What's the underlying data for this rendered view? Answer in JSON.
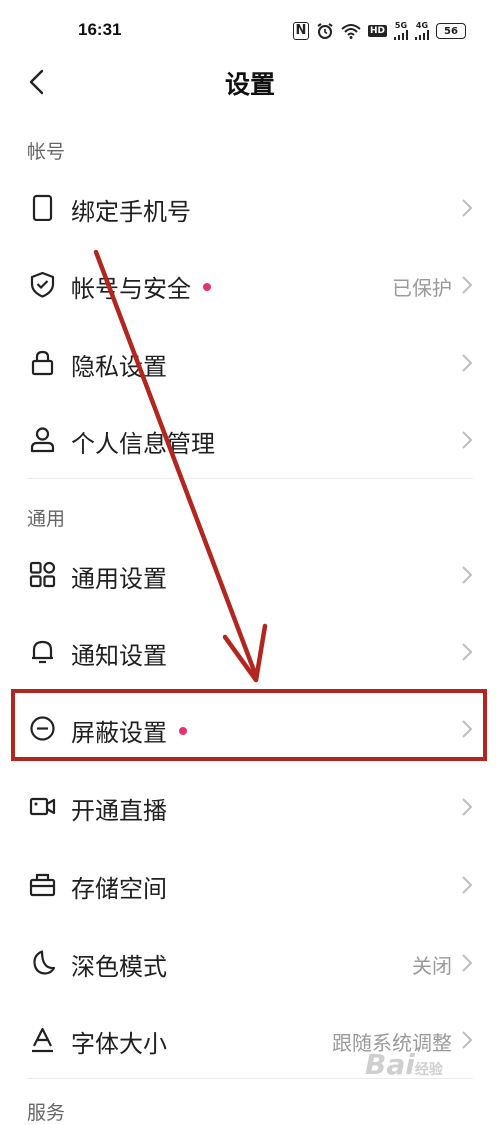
{
  "status_bar": {
    "time": "16:31",
    "nfc": "N",
    "hd": "HD",
    "signal1": "5G",
    "signal2": "4G",
    "battery": "56"
  },
  "header": {
    "title": "设置"
  },
  "sections": {
    "account": {
      "title": "帐号"
    },
    "general": {
      "title": "通用"
    },
    "service": {
      "title": "服务"
    }
  },
  "rows": {
    "bind_phone": {
      "label": "绑定手机号"
    },
    "account_security": {
      "label": "帐号与安全",
      "value": "已保护"
    },
    "privacy": {
      "label": "隐私设置"
    },
    "personal_info": {
      "label": "个人信息管理"
    },
    "general_settings": {
      "label": "通用设置"
    },
    "notification": {
      "label": "通知设置"
    },
    "block": {
      "label": "屏蔽设置"
    },
    "live": {
      "label": "开通直播"
    },
    "storage": {
      "label": "存储空间"
    },
    "dark_mode": {
      "label": "深色模式",
      "value": "关闭"
    },
    "font_size": {
      "label": "字体大小",
      "value": "跟随系统调整"
    }
  },
  "watermark": {
    "text": "Bai",
    "sub": "经验"
  },
  "colors": {
    "accent_dot": "#e8326a",
    "annotation": "#b3261f"
  },
  "icons": [
    "back-chevron-icon",
    "phone-icon",
    "shield-check-icon",
    "lock-icon",
    "person-icon",
    "grid-icon",
    "bell-icon",
    "block-circle-icon",
    "video-camera-icon",
    "storage-box-icon",
    "moon-icon",
    "font-a-icon",
    "chevron-right-icon"
  ]
}
